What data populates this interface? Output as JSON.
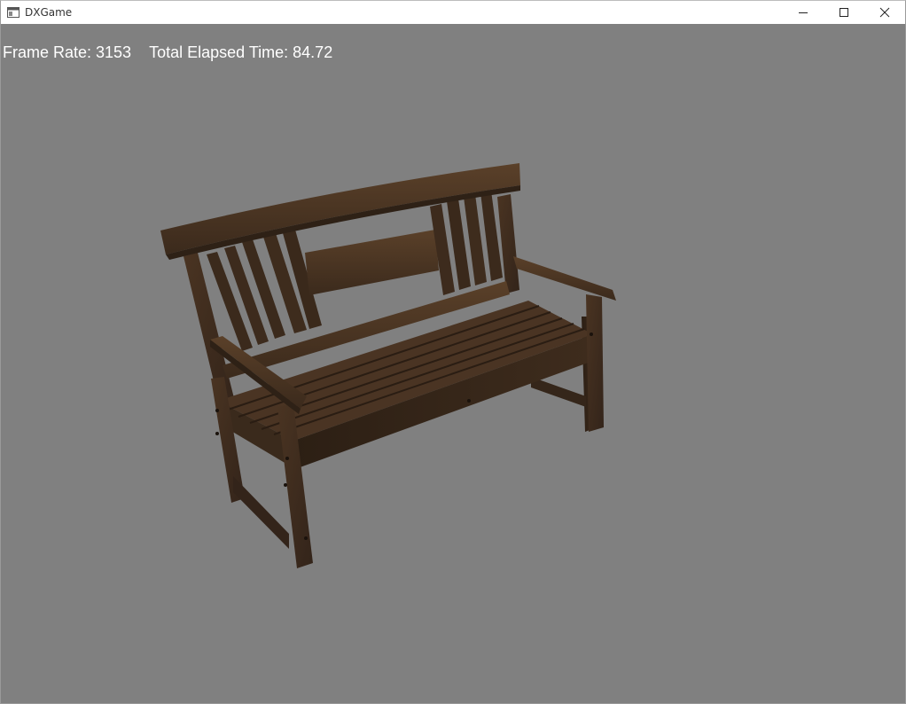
{
  "window": {
    "title": "DXGame",
    "controls": {
      "minimize_icon": "minimize-icon",
      "maximize_icon": "maximize-icon",
      "close_icon": "close-icon"
    }
  },
  "hud": {
    "frame_rate_label": "Frame Rate: 3153",
    "elapsed_label": "Total Elapsed Time: 84.72"
  },
  "scene": {
    "background": "#808080",
    "object": "wooden-bench",
    "wood_color": "#3f2c1c"
  }
}
